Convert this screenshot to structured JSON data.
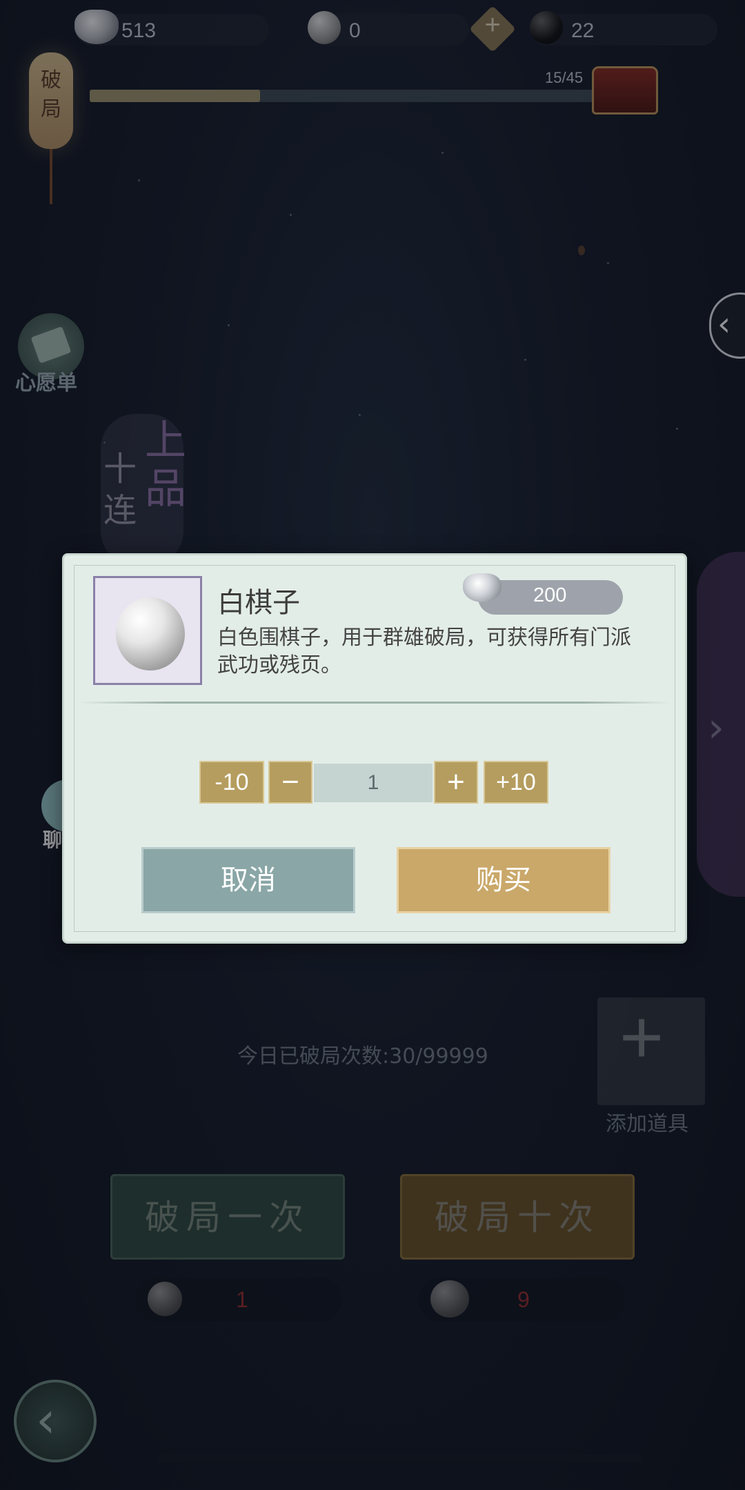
{
  "top_bar": {
    "silver_count": "513",
    "white_stone_count": "0",
    "black_stone_count": "22",
    "add_icon": "plus-icon"
  },
  "progress": {
    "label": "15/45",
    "value": 15,
    "max": 45
  },
  "lantern": {
    "text_1": "破",
    "text_2": "局"
  },
  "wishlist": {
    "label": "心愿单"
  },
  "chat": {
    "label": "聊天"
  },
  "background_text": {
    "banner_chars": [
      "上",
      "品",
      "十",
      "连"
    ],
    "today_count": "今日已破局次数:30/99999",
    "add_item": "添加道具",
    "break_once": "破局一次",
    "break_ten": "破局十次",
    "cost_once": "1",
    "cost_ten": "9"
  },
  "modal": {
    "item_name": "白棋子",
    "price": "200",
    "description": "白色围棋子，用于群雄破局，可获得所有门派武功或残页。",
    "minus_ten": "-10",
    "minus": "−",
    "quantity": "1",
    "plus": "+",
    "plus_ten": "+10",
    "cancel": "取消",
    "buy": "购买"
  },
  "colors": {
    "modal_bg": "#e3ede8",
    "gold_button": "#b59d5f",
    "cancel_button": "#8aa6a6",
    "buy_button": "#caa86a"
  }
}
